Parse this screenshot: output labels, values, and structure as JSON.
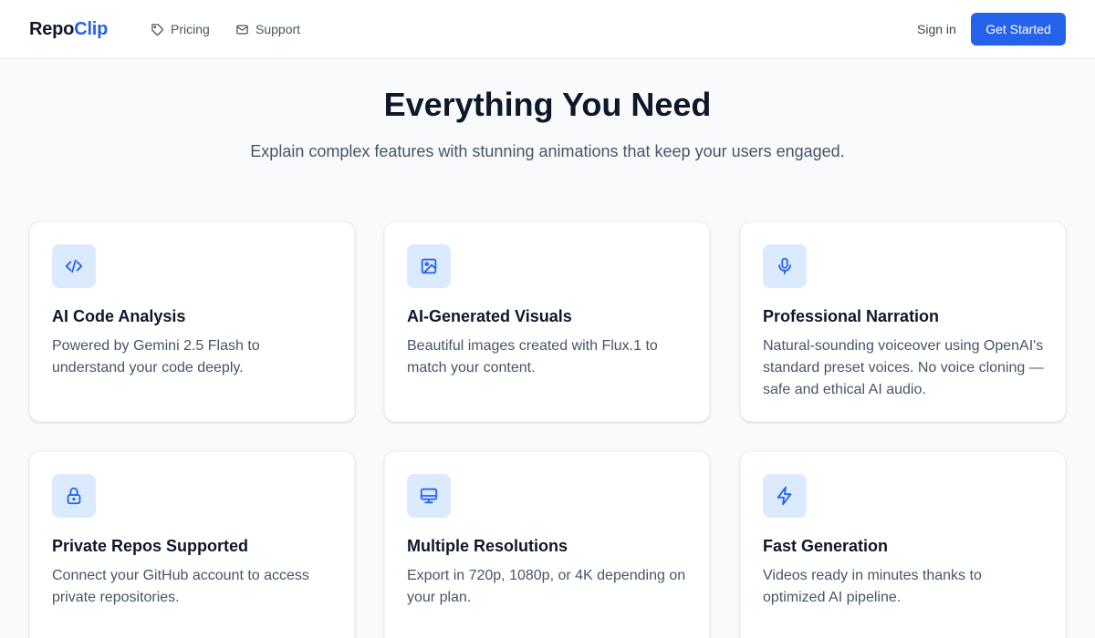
{
  "brand": {
    "part1": "Repo",
    "part2": "Clip"
  },
  "nav": {
    "links": [
      {
        "label": "Pricing",
        "icon": "tag-icon"
      },
      {
        "label": "Support",
        "icon": "mail-icon"
      }
    ],
    "sign_in": "Sign in",
    "cta": "Get Started"
  },
  "hero": {
    "title": "Everything You Need",
    "subtitle": "Explain complex features with stunning animations that keep your users engaged."
  },
  "features": [
    {
      "icon": "code-icon",
      "title": "AI Code Analysis",
      "desc": "Powered by Gemini 2.5 Flash to understand your code deeply."
    },
    {
      "icon": "image-icon",
      "title": "AI-Generated Visuals",
      "desc": "Beautiful images created with Flux.1 to match your content."
    },
    {
      "icon": "microphone-icon",
      "title": "Professional Narration",
      "desc": "Natural-sounding voiceover using OpenAI's standard preset voices. No voice cloning — safe and ethical AI audio."
    },
    {
      "icon": "lock-icon",
      "title": "Private Repos Supported",
      "desc": "Connect your GitHub account to access private repositories."
    },
    {
      "icon": "monitor-icon",
      "title": "Multiple Resolutions",
      "desc": "Export in 720p, 1080p, or 4K depending on your plan."
    },
    {
      "icon": "lightning-icon",
      "title": "Fast Generation",
      "desc": "Videos ready in minutes thanks to optimized AI pipeline."
    }
  ],
  "colors": {
    "accent": "#2563eb",
    "icon_bg": "#dbeafe",
    "page_bg": "#f8fafc"
  }
}
